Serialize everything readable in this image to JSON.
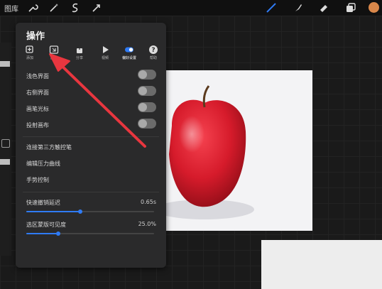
{
  "topbar": {
    "gallery_label": "图库",
    "tools": [
      "wrench-icon",
      "magic-wand-icon",
      "selection-icon",
      "transform-icon"
    ],
    "right_tools": [
      "brush-icon",
      "smudge-icon",
      "eraser-icon",
      "layers-icon"
    ]
  },
  "panel": {
    "title": "操作",
    "tabs": [
      {
        "label": "添加",
        "icon": "add-icon"
      },
      {
        "label": "画布",
        "icon": "canvas-icon"
      },
      {
        "label": "分享",
        "icon": "share-icon"
      },
      {
        "label": "视频",
        "icon": "video-icon"
      },
      {
        "label": "偏好设置",
        "icon": "prefs-toggle-icon"
      },
      {
        "label": "帮助",
        "icon": "help-icon"
      }
    ],
    "toggles": [
      {
        "label": "浅色界面"
      },
      {
        "label": "右侧界面"
      },
      {
        "label": "画笔光标"
      },
      {
        "label": "投射画布"
      }
    ],
    "links": [
      "连接第三方触控笔",
      "编辑压力曲线",
      "手势控制"
    ],
    "sliders": [
      {
        "label": "快速撤销延迟",
        "value": "0.65s",
        "fraction": 0.42
      },
      {
        "label": "选区蒙版可见度",
        "value": "25.0%",
        "fraction": 0.25
      }
    ]
  },
  "colors": {
    "accent": "#2f7bf5",
    "annotation_arrow": "#e8363f"
  }
}
